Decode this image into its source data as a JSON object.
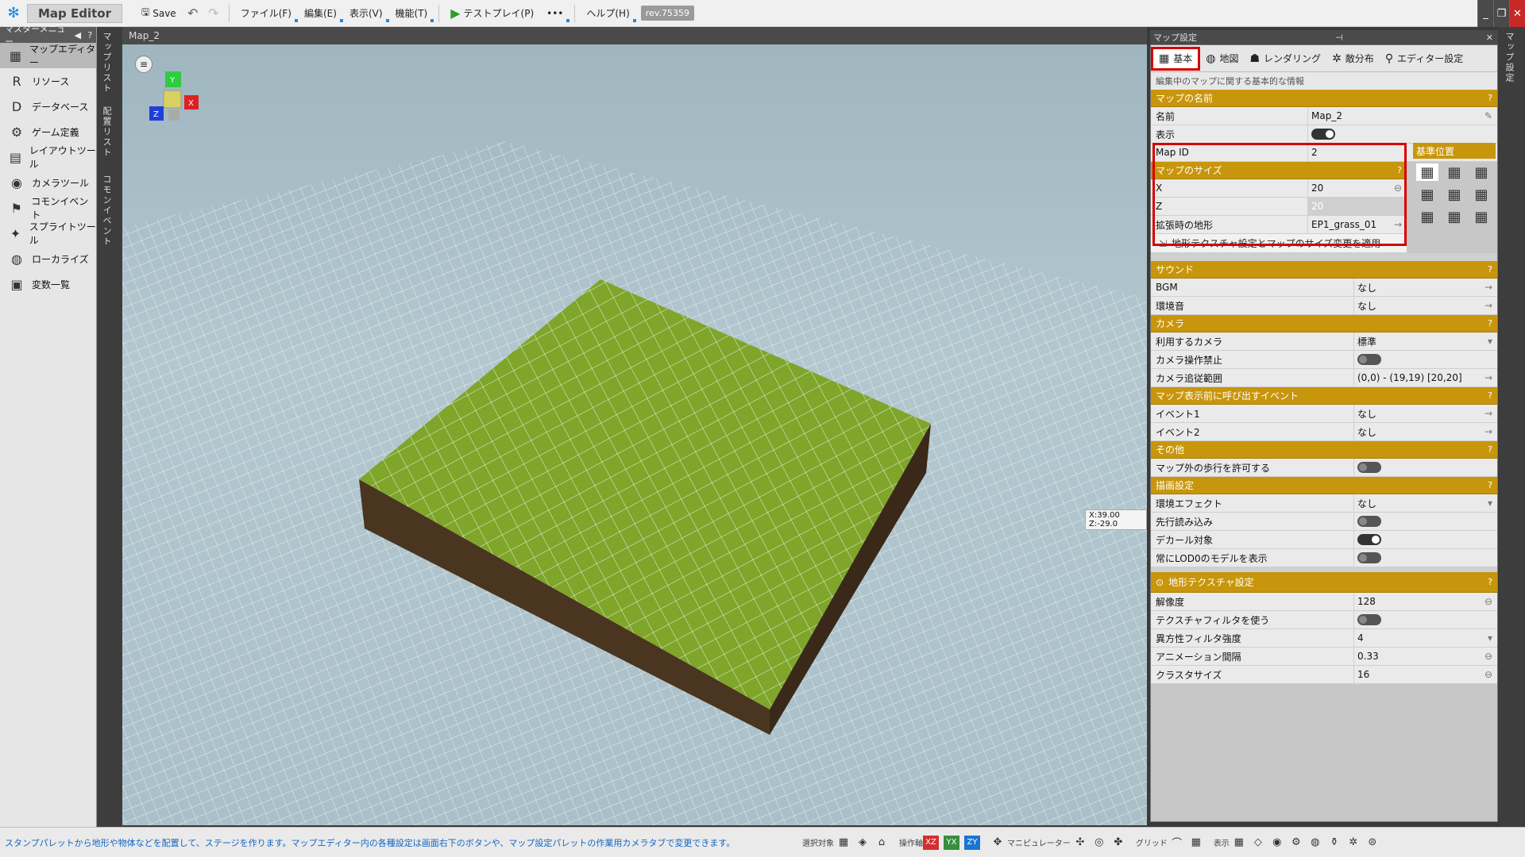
{
  "titlebar": {
    "app_name": "Map Editor",
    "save_label": "Save",
    "menus": [
      "ファイル(F)",
      "編集(E)",
      "表示(V)",
      "機能(T)"
    ],
    "testplay_label": "テストプレイ(P)",
    "more_label": "•••",
    "help_label": "ヘルプ(H)",
    "revision": "rev.75359"
  },
  "master_menu": {
    "title": "マスターメニュー",
    "items": [
      "マップエディター",
      "リソース",
      "データベース",
      "ゲーム定義",
      "レイアウトツール",
      "カメラツール",
      "コモンイベント",
      "スプライトツール",
      "ローカライズ",
      "変数一覧"
    ]
  },
  "side_tabs": [
    "マップリスト",
    "配置リスト",
    "コモンイベント"
  ],
  "viewport": {
    "title": "Map_2",
    "coord_readout": "X:39.00 Z:-29.0"
  },
  "right_panel": {
    "title": "マップ設定",
    "side_label": "マップ設定",
    "tabs": [
      "基本",
      "地図",
      "レンダリング",
      "敵分布",
      "エディター設定"
    ],
    "description": "編集中のマップに関する基本的な情報",
    "map_name_section": {
      "header": "マップの名前",
      "rows": [
        {
          "key": "名前",
          "value": "Map_2"
        },
        {
          "key": "表示",
          "value": ""
        },
        {
          "key": "Map ID",
          "value": "2"
        }
      ]
    },
    "map_size_section": {
      "header": "マップのサイズ",
      "anchor_header": "基準位置",
      "rows": [
        {
          "key": "X",
          "value": "20"
        },
        {
          "key": "Z",
          "value": "20"
        },
        {
          "key": "拡張時の地形",
          "value": "EP1_grass_01"
        }
      ],
      "apply_label": "地形テクスチャ設定とマップのサイズ変更を適用"
    },
    "sound_section": {
      "header": "サウンド",
      "rows": [
        {
          "key": "BGM",
          "value": "なし"
        },
        {
          "key": "環境音",
          "value": "なし"
        }
      ]
    },
    "camera_section": {
      "header": "カメラ",
      "rows": [
        {
          "key": "利用するカメラ",
          "value": "標準"
        },
        {
          "key": "カメラ操作禁止",
          "value": ""
        },
        {
          "key": "カメラ追従範囲",
          "value": "(0,0) - (19,19) [20,20]"
        }
      ]
    },
    "event_section": {
      "header": "マップ表示前に呼び出すイベント",
      "rows": [
        {
          "key": "イベント1",
          "value": "なし"
        },
        {
          "key": "イベント2",
          "value": "なし"
        }
      ]
    },
    "other_section": {
      "header": "その他",
      "rows": [
        {
          "key": "マップ外の歩行を許可する",
          "value": ""
        }
      ]
    },
    "render_section": {
      "header": "描画設定",
      "rows": [
        {
          "key": "環境エフェクト",
          "value": "なし"
        },
        {
          "key": "先行読み込み",
          "value": ""
        },
        {
          "key": "デカール対象",
          "value": ""
        },
        {
          "key": "常にLOD0のモデルを表示",
          "value": ""
        }
      ]
    },
    "terrain_section": {
      "header": "地形テクスチャ設定",
      "rows": [
        {
          "key": "解像度",
          "value": "128"
        },
        {
          "key": "テクスチャフィルタを使う",
          "value": ""
        },
        {
          "key": "異方性フィルタ強度",
          "value": "4"
        },
        {
          "key": "アニメーション間隔",
          "value": "0.33"
        },
        {
          "key": "クラスタサイズ",
          "value": "16"
        }
      ]
    }
  },
  "statusbar": {
    "message": "スタンプパレットから地形や物体などを配置して、ステージを作ります。マップエディター内の各種設定は画面右下のボタンや、マップ設定パレットの作業用カメラタブで変更できます。",
    "select_label": "選択対象",
    "axis_label": "操作軸",
    "xz": "XZ",
    "yx": "YX",
    "zy": "ZY",
    "manipulator_label": "マニピュレーター",
    "grid_label": "グリッド",
    "display_label": "表示"
  },
  "colors": {
    "section": "#c8960c",
    "highlight": "#d50000",
    "grass": "#7fa52a",
    "dirt": "#4a3520"
  }
}
